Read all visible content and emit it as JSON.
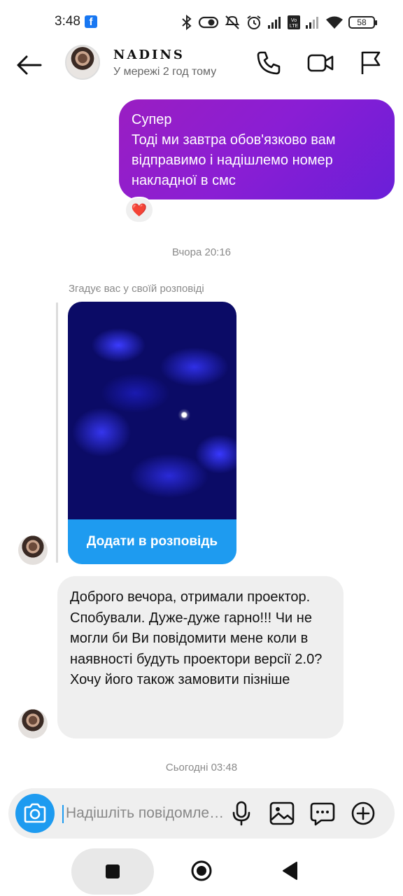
{
  "status_bar": {
    "time": "3:48",
    "battery": "58",
    "notification_icon": "facebook-icon",
    "icons": [
      "bluetooth-icon",
      "vpn-key-icon",
      "mute-icon",
      "alarm-icon",
      "cell-signal-icon",
      "volte-icon",
      "wifi-icon",
      "battery-icon"
    ]
  },
  "header": {
    "name": "NADINS",
    "status": "У мережі 2 год тому"
  },
  "thread": {
    "outgoing_message": "Супер\nТоді ми завтра обов'язково вам відправимо і надішлемо номер накладної в смс",
    "reaction": "❤️",
    "date_yesterday": "Вчора 20:16",
    "story_caption": "Згадує вас у своїй розповіді",
    "story_button": "Додати в розповідь",
    "incoming_message": "Доброго вечора, отримали проектор. Спобували. Дуже-дуже гарно!!! Чи не могли би Ви повідомити мене коли в наявності будуть проектори версії 2.0? Хочу його також замовити пізніше",
    "date_today": "Сьогодні 03:48"
  },
  "composer": {
    "placeholder": "Надішліть повідомлення..."
  },
  "colors": {
    "accent_blue": "#1e9bf0",
    "outgoing_gradient_start": "#9a1ec2",
    "outgoing_gradient_end": "#6a1fd8",
    "incoming_bg": "#efefef"
  }
}
